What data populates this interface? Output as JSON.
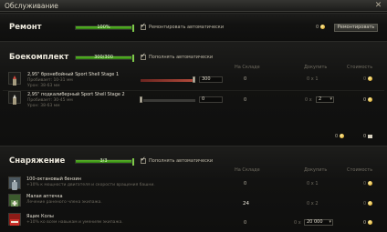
{
  "window": {
    "title": "Обслуживание",
    "close_glyph": "✕"
  },
  "repair": {
    "title": "Ремонт",
    "progress_label": "100%",
    "progress_fraction": 1.0,
    "auto_label": "Ремонтировать автоматически",
    "auto_checked": true,
    "cost": "0",
    "button_label": "Ремонтировать"
  },
  "ammo": {
    "title": "Боекомплект",
    "progress_label": "300/300",
    "progress_fraction": 1.0,
    "auto_label": "Пополнять автоматически",
    "auto_checked": true,
    "columns": [
      "На Складе",
      "Докупить",
      "Стоимость"
    ],
    "shells": [
      {
        "name": "2,95\" бронебойный Sport Shell Stage 1",
        "pen": "Пробивает: 10-31 мм",
        "dmg": "Урон: 38-63 мм",
        "count": "300",
        "stock": "0",
        "buy": "0 x 1",
        "cost": "0",
        "icon": "shell-ap-icon",
        "fill_fraction": 1.0
      },
      {
        "name": "2,95\" подкалиберный Sport Shell Stage 2",
        "pen": "Пробивает: 30-45 мм",
        "dmg": "Урон: 38-63 мм",
        "count": "0",
        "stock": "0",
        "buy_prefix": "0 x",
        "buy_value": "2",
        "cost": "0",
        "icon": "shell-apcr-icon",
        "fill_fraction": 0.0
      }
    ],
    "total_credits": "0",
    "total_gold": "0"
  },
  "equipment": {
    "title": "Снаряжение",
    "progress_label": "3/3",
    "progress_fraction": 1.0,
    "auto_label": "Пополнять автоматически",
    "auto_checked": true,
    "columns": [
      "На Складе",
      "Докупить",
      "Стоимость"
    ],
    "items": [
      {
        "name": "100-октановый бензин",
        "desc": "+10% к мощности двигателя и скорости вращения башни.",
        "stock": "0",
        "buy": "0 x 1",
        "cost": "0",
        "icon": "fuel-icon",
        "color": "#7b8a95"
      },
      {
        "name": "Малая аптечка",
        "desc": "Лечение раненого члена экипажа.",
        "stock": "24",
        "buy": "0 x 2",
        "cost": "0",
        "icon": "first-aid-icon",
        "color": "#4f7a3d"
      },
      {
        "name": "Ящик Колы",
        "desc": "+10% ко всем навыкам и умениям экипажа.",
        "stock": "0",
        "buy_prefix": "0 x",
        "buy_value": "20 000",
        "cost": "0",
        "icon": "cola-crate-icon",
        "color": "#b3231d"
      }
    ]
  }
}
